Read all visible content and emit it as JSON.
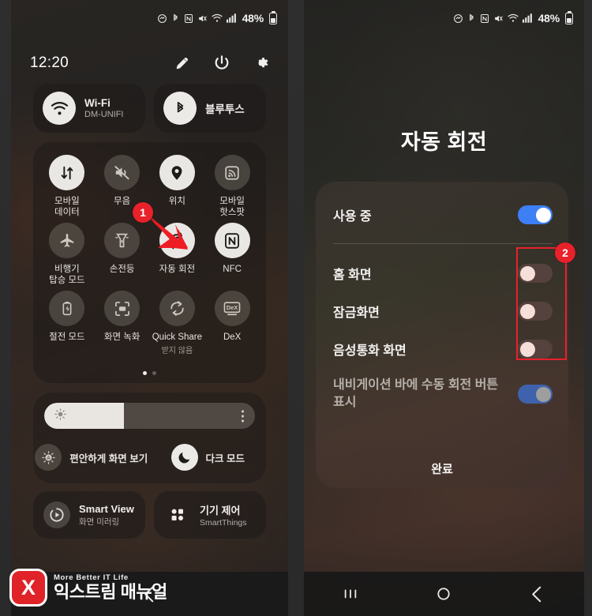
{
  "status_bar": {
    "battery_percent": "48%",
    "icons": [
      "dnd-icon",
      "bluetooth-icon",
      "nfc-icon",
      "mute-icon",
      "wifi-icon",
      "signal-icon"
    ]
  },
  "left_panel": {
    "clock": "12:20",
    "header_actions": [
      {
        "name": "edit-pencil-icon",
        "label": "편집"
      },
      {
        "name": "power-icon",
        "label": "전원"
      },
      {
        "name": "settings-gear-icon",
        "label": "설정"
      }
    ],
    "pair_tiles": [
      {
        "name": "wifi-tile",
        "icon": "wifi-icon",
        "title": "Wi-Fi",
        "subtitle": "DM-UNIFI",
        "on": true
      },
      {
        "name": "bluetooth-tile",
        "icon": "bluetooth-icon",
        "title": "블루투스",
        "subtitle": "",
        "on": true
      }
    ],
    "grid_tiles": [
      {
        "name": "mobile-data-tile",
        "icon": "data-arrows-icon",
        "label": "모바일\n데이터",
        "on": true,
        "sub": ""
      },
      {
        "name": "mute-tile",
        "icon": "speaker-mute-icon",
        "label": "무음",
        "on": false,
        "sub": ""
      },
      {
        "name": "location-tile",
        "icon": "location-pin-icon",
        "label": "위치",
        "on": true,
        "sub": ""
      },
      {
        "name": "mobile-hotspot-tile",
        "icon": "hotspot-icon",
        "label": "모바일\n핫스팟",
        "on": false,
        "sub": ""
      },
      {
        "name": "airplane-mode-tile",
        "icon": "airplane-icon",
        "label": "비행기\n탑승 모드",
        "on": false,
        "sub": ""
      },
      {
        "name": "flashlight-tile",
        "icon": "flashlight-icon",
        "label": "손전등",
        "on": false,
        "sub": ""
      },
      {
        "name": "auto-rotate-tile",
        "icon": "auto-rotate-icon",
        "label": "자동 회전",
        "on": true,
        "sub": ""
      },
      {
        "name": "nfc-tile",
        "icon": "nfc-icon",
        "label": "NFC",
        "on": true,
        "sub": ""
      },
      {
        "name": "power-saving-tile",
        "icon": "battery-saver-icon",
        "label": "절전 모드",
        "on": false,
        "sub": ""
      },
      {
        "name": "screen-recorder-tile",
        "icon": "screen-record-icon",
        "label": "화면 녹화",
        "on": false,
        "sub": ""
      },
      {
        "name": "quick-share-tile",
        "icon": "quick-share-icon",
        "label": "Quick Share",
        "on": false,
        "sub": "받지 않음"
      },
      {
        "name": "dex-tile",
        "icon": "dex-icon",
        "label": "DeX",
        "on": false,
        "sub": ""
      }
    ],
    "page_dots": {
      "count": 2,
      "active_index": 0
    },
    "brightness": {
      "name": "brightness-slider",
      "icon": "brightness-sun-icon",
      "fill_percent": 38,
      "kebab_name": "brightness-more-button"
    },
    "brightness_shortcuts": [
      {
        "name": "eye-comfort-shield-button",
        "icon": "eye-comfort-icon",
        "label": "편안하게 화면 보기",
        "on": false
      },
      {
        "name": "dark-mode-button",
        "icon": "moon-icon",
        "label": "다크 모드",
        "on": true
      }
    ],
    "bottom_tiles": [
      {
        "name": "smart-view-tile",
        "icon": "smart-view-icon",
        "title": "Smart View",
        "subtitle": "화면 미러링"
      },
      {
        "name": "device-control-tile",
        "icon": "smartthings-grid-icon",
        "title": "기기 제어",
        "subtitle": "SmartThings"
      }
    ],
    "navbar": [
      {
        "name": "nav-back-button",
        "icon": "chevron-left-icon"
      }
    ]
  },
  "right_panel": {
    "title": "자동 회전",
    "dialog": {
      "master_row": {
        "name": "auto-rotate-master-row",
        "label": "사용 중",
        "toggle": "on"
      },
      "rows": [
        {
          "name": "home-screen-row",
          "label": "홈 화면",
          "toggle": "off"
        },
        {
          "name": "lock-screen-row",
          "label": "잠금화면",
          "toggle": "off"
        },
        {
          "name": "voice-call-screen-row",
          "label": "음성통화 화면",
          "toggle": "off"
        },
        {
          "name": "navbar-rotate-button-row",
          "label": "내비게이션 바에 수동 회전 버튼 표시",
          "toggle": "on-disabled"
        }
      ],
      "done_label": "완료"
    },
    "navbar": [
      {
        "name": "nav-recents-button",
        "icon": "recents-icon"
      },
      {
        "name": "nav-home-button",
        "icon": "home-circle-icon"
      },
      {
        "name": "nav-back-button",
        "icon": "chevron-left-icon"
      }
    ]
  },
  "annotations": [
    {
      "name": "annotation-badge-1",
      "number": "1",
      "color": "#e8212b"
    },
    {
      "name": "annotation-badge-2",
      "number": "2",
      "color": "#e8212b"
    }
  ],
  "watermark": {
    "logo_letter": "X",
    "tagline": "More Better IT Life",
    "brand": "익스트림 매뉴얼"
  }
}
